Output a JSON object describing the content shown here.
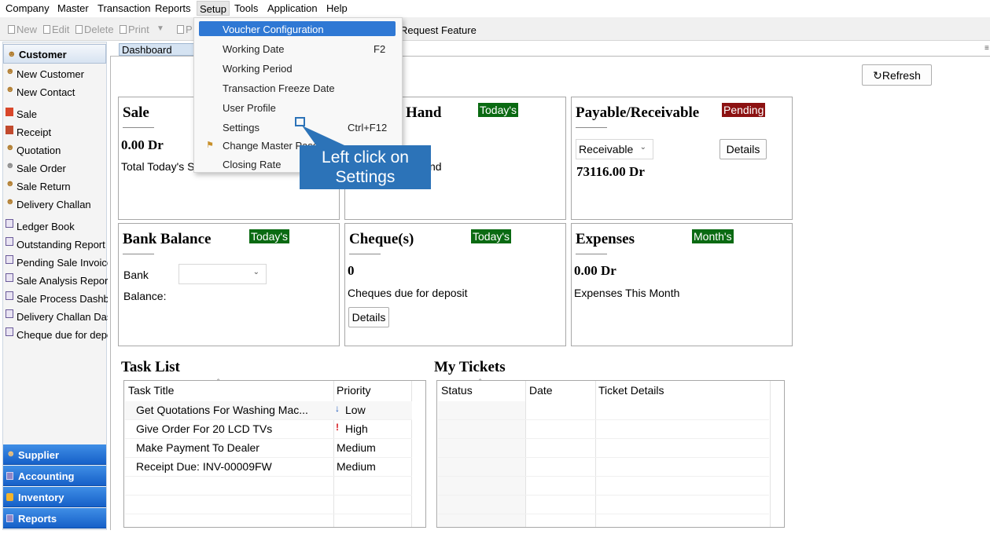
{
  "menubar": [
    "Company",
    "Master",
    "Transaction",
    "Reports",
    "Setup",
    "Tools",
    "Application",
    "Help"
  ],
  "toolbar": {
    "new": "New",
    "edit": "Edit",
    "delete": "Delete",
    "print": "Print",
    "p": "P",
    "request": "Request Feature"
  },
  "sidebar": {
    "header": "Customer",
    "items": [
      "New Customer",
      "New Contact",
      "Sale",
      "Receipt",
      "Quotation",
      "Sale Order",
      "Sale Return",
      "Delivery Challan",
      "Ledger Book",
      "Outstanding Report",
      "Pending Sale Invoices",
      "Sale Analysis Report",
      "Sale Process Dashboa",
      "Delivery Challan Dashl",
      "Cheque due for depo:"
    ],
    "groups": [
      "Supplier",
      "Accounting",
      "Inventory",
      "Reports"
    ]
  },
  "tab": "Dashboard",
  "refresh": "Refresh",
  "cards": {
    "sale": {
      "title": "Sale",
      "amount": "0.00 Dr",
      "text": "Total Today's S"
    },
    "cash": {
      "title": "Hand",
      "badge": "Today's",
      "text": "nd"
    },
    "payable": {
      "title": "Payable/Receivable",
      "badge": "Pending",
      "select": "Receivable",
      "button": "Details",
      "amount": "73116.00 Dr"
    },
    "bank": {
      "title": "Bank Balance",
      "badge": "Today's",
      "bank_label": "Bank",
      "balance_label": "Balance:"
    },
    "cheque": {
      "title": "Cheque(s)",
      "badge": "Today's",
      "amount": "0",
      "text": "Cheques due for deposit",
      "button": "Details"
    },
    "expenses": {
      "title": "Expenses",
      "badge": "Month's",
      "amount": "0.00 Dr",
      "text": "Expenses This Month"
    }
  },
  "tasks": {
    "title": "Task List",
    "columns": [
      "Task Title",
      "Priority"
    ],
    "rows": [
      {
        "title": "Get Quotations For Washing Mac...",
        "priority": "Low",
        "icon": "↓"
      },
      {
        "title": "Give Order For 20 LCD TVs",
        "priority": "High",
        "icon": "!"
      },
      {
        "title": "Make Payment To Dealer",
        "priority": "Medium",
        "icon": ""
      },
      {
        "title": "Receipt Due: INV-00009FW",
        "priority": "Medium",
        "icon": ""
      }
    ]
  },
  "tickets": {
    "title": "My Tickets",
    "columns": [
      "Status",
      "Date",
      "Ticket Details"
    ]
  },
  "dropdown": {
    "items": [
      {
        "label": "Voucher Configuration",
        "shortcut": ""
      },
      {
        "label": "Working Date",
        "shortcut": "F2"
      },
      {
        "label": "Working Period",
        "shortcut": ""
      },
      {
        "label": "Transaction Freeze Date",
        "shortcut": ""
      },
      {
        "label": "User Profile",
        "shortcut": ""
      },
      {
        "label": "Settings",
        "shortcut": "Ctrl+F12"
      },
      {
        "label": "Change Master Passwo",
        "shortcut": ""
      },
      {
        "label": "Closing Rate",
        "shortcut": ""
      }
    ]
  },
  "callout": {
    "line1": "Left click on",
    "line2": "Settings"
  },
  "colors": {
    "accent": "#2f78d4",
    "callout": "#2c73b8",
    "badge_green": "#0a6a12",
    "badge_red": "#8c1212"
  }
}
